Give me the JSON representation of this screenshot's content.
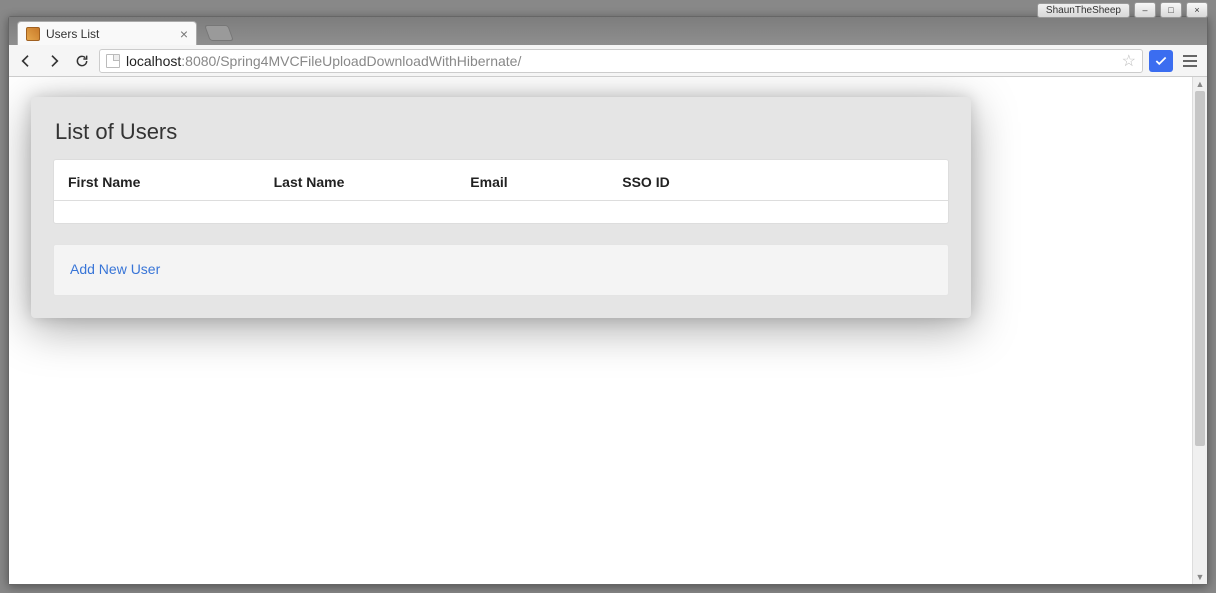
{
  "os": {
    "app_label": "ShaunTheSheep",
    "minimize": "–",
    "maximize": "□",
    "close": "×"
  },
  "browser": {
    "tab": {
      "title": "Users List",
      "close": "×"
    },
    "url_host": "localhost",
    "url_port_path": ":8080/Spring4MVCFileUploadDownloadWithHibernate/"
  },
  "page": {
    "heading": "List of Users",
    "columns": {
      "c0": "First Name",
      "c1": "Last Name",
      "c2": "Email",
      "c3": "SSO ID"
    },
    "add_link": "Add New User"
  }
}
